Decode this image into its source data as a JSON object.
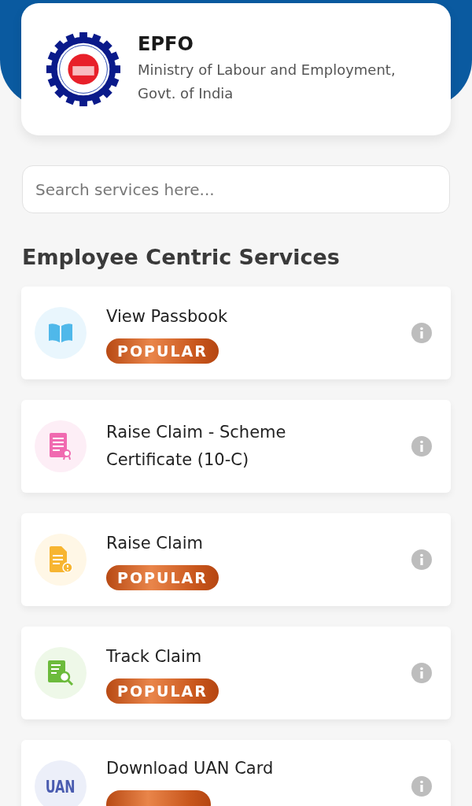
{
  "header": {
    "title": "EPFO",
    "subtitle": "Ministry of Labour and Employment, Govt. of India"
  },
  "search": {
    "placeholder": "Search services here..."
  },
  "section_title": "Employee Centric Services",
  "services": [
    {
      "title": "View Passbook",
      "kind": "book",
      "color": "#4fb8ea",
      "popular": true,
      "badge": "POPULAR"
    },
    {
      "title": "Raise Claim - Scheme Certificate (10-C)",
      "kind": "certificate",
      "color": "#f06ab0",
      "popular": false
    },
    {
      "title": "Raise Claim",
      "kind": "document-alert",
      "color": "#f7b531",
      "popular": true,
      "badge": "POPULAR"
    },
    {
      "title": "Track Claim",
      "kind": "document-search",
      "color": "#6cbb3c",
      "popular": true,
      "badge": "POPULAR"
    },
    {
      "title": "Download UAN Card",
      "kind": "text",
      "icon_text": "UAN",
      "color": "#4a5cb0",
      "popular": true
    }
  ]
}
